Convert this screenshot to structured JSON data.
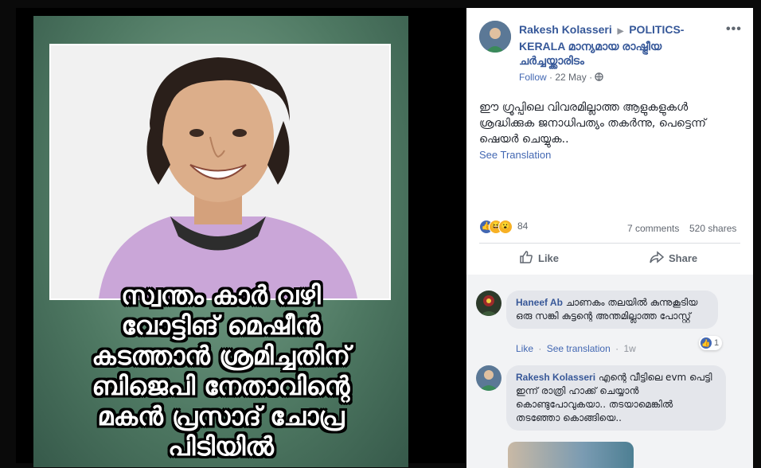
{
  "image_caption": {
    "lines": [
      "സ്വന്തം കാർ വഴി",
      "വോട്ടിങ് മെഷീൻ",
      "കടത്താൻ ശ്രമിച്ചതിന്",
      "ബിജെപി നേതാവിന്റെ",
      "മകൻ പ്രസാദ് ചോപ്ര",
      "പിടിയിൽ"
    ]
  },
  "post": {
    "author": "Rakesh Kolasseri",
    "group": "POLITICS-KERALA മാന്യമായ രാഷ്ട്രീയ ചർച്ചയ്ക്കാരിടം",
    "follow_label": "Follow",
    "date": "22 May",
    "text": "ഈ ഗ്രൂപ്പിലെ വിവരമില്ലാത്ത ആളുകളുകൾ ശ്രദ്ധിക്കുക ജനാധിപത്യം തകർന്നു, പെട്ടെന്ന് ഷെയർ ചെയ്യുക..",
    "see_translation": "See Translation",
    "reaction_count": "84",
    "comments": "7 comments",
    "shares": "520 shares",
    "like_label": "Like",
    "share_label": "Share"
  },
  "comments": [
    {
      "name": "Haneef Ab",
      "text": "ചാണകം തലയിൽ കുന്നുകൂടിയ ഒരു സങ്കി കുട്ടന്റെ അന്തമില്ലാത്ത പോസ്റ്റ്",
      "like": "Like",
      "see_translation": "See translation",
      "time": "1w",
      "reaction_count": "1"
    },
    {
      "name": "Rakesh Kolasseri",
      "text": "എന്റെ വീട്ടിലെ evm പെട്ടി ഇന്ന് രാത്രി ഹാക്ക് ചെയ്യാൻ കൊണ്ടുപോവുകയാ.. തടയാമെങ്കിൽ തടഞ്ഞോ കൊങ്ങിയെ.."
    }
  ],
  "icons": {
    "more": "more-icon",
    "globe": "globe-icon",
    "like": "like-icon",
    "share": "share-icon"
  },
  "colors": {
    "link": "#365899",
    "accent": "#4267b2"
  }
}
